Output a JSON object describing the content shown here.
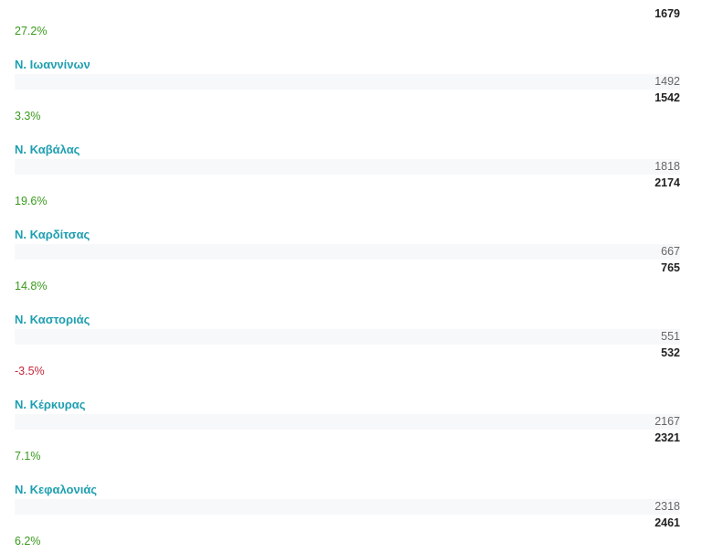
{
  "top": {
    "new_value": "1679",
    "change": "27.2%",
    "change_sign": "positive"
  },
  "regions": [
    {
      "name": "Ν. Ιωαννίνων",
      "old_value": "1492",
      "new_value": "1542",
      "change": "3.3%",
      "change_sign": "positive"
    },
    {
      "name": "Ν. Καβάλας",
      "old_value": "1818",
      "new_value": "2174",
      "change": "19.6%",
      "change_sign": "positive"
    },
    {
      "name": "Ν. Καρδίτσας",
      "old_value": "667",
      "new_value": "765",
      "change": "14.8%",
      "change_sign": "positive"
    },
    {
      "name": "Ν. Καστοριάς",
      "old_value": "551",
      "new_value": "532",
      "change": "-3.5%",
      "change_sign": "negative"
    },
    {
      "name": "Ν. Κέρκυρας",
      "old_value": "2167",
      "new_value": "2321",
      "change": "7.1%",
      "change_sign": "positive"
    },
    {
      "name": "Ν. Κεφαλονιάς",
      "old_value": "2318",
      "new_value": "2461",
      "change": "6.2%",
      "change_sign": "positive"
    }
  ],
  "colors": {
    "region_name": "#1e9fb0",
    "positive": "#3a9a1e",
    "negative": "#c4283c"
  }
}
